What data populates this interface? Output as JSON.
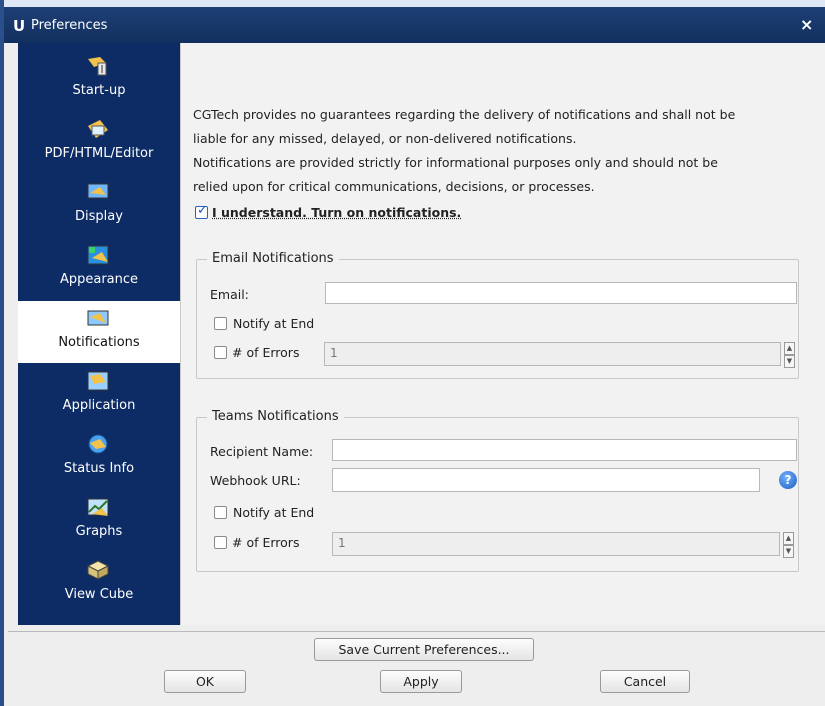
{
  "window": {
    "logo": "U",
    "title": "Preferences",
    "close_glyph": "×"
  },
  "sidebar": {
    "items": [
      {
        "label": "Start-up",
        "icon": "startup-icon"
      },
      {
        "label": "PDF/HTML/Editor",
        "icon": "pdf-editor-icon"
      },
      {
        "label": "Display",
        "icon": "display-icon"
      },
      {
        "label": "Appearance",
        "icon": "appearance-icon"
      },
      {
        "label": "Notifications",
        "icon": "notifications-icon",
        "selected": true
      },
      {
        "label": "Application",
        "icon": "application-icon"
      },
      {
        "label": "Status Info",
        "icon": "status-info-icon"
      },
      {
        "label": "Graphs",
        "icon": "graphs-icon"
      },
      {
        "label": "View Cube",
        "icon": "view-cube-icon"
      }
    ]
  },
  "disclaimer": {
    "line1": "CGTech provides no guarantees regarding the delivery of notifications and shall not be",
    "line2": "liable for any missed, delayed, or non-delivered notifications.",
    "line3": "Notifications are provided strictly for informational purposes only and should not be",
    "line4": "relied upon for critical communications, decisions, or processes.",
    "consent_label": "I understand. Turn on notifications.",
    "consent_checked": true
  },
  "email": {
    "legend": "Email Notifications",
    "email_label": "Email:",
    "email_value": "",
    "notify_end_label": "Notify at End",
    "errors_label": "# of Errors",
    "errors_value": "1"
  },
  "teams": {
    "legend": "Teams Notifications",
    "recipient_label": "Recipient Name:",
    "recipient_value": "",
    "webhook_label": "Webhook URL:",
    "webhook_value": "",
    "help_glyph": "?",
    "notify_end_label": "Notify at End",
    "errors_label": "# of Errors",
    "errors_value": "1"
  },
  "footer": {
    "save_label": "Save Current Preferences...",
    "ok_label": "OK",
    "apply_label": "Apply",
    "cancel_label": "Cancel"
  },
  "colors": {
    "titlebar": "#12305e",
    "sidebar": "#0d2c66",
    "accent": "#1e55b3"
  }
}
